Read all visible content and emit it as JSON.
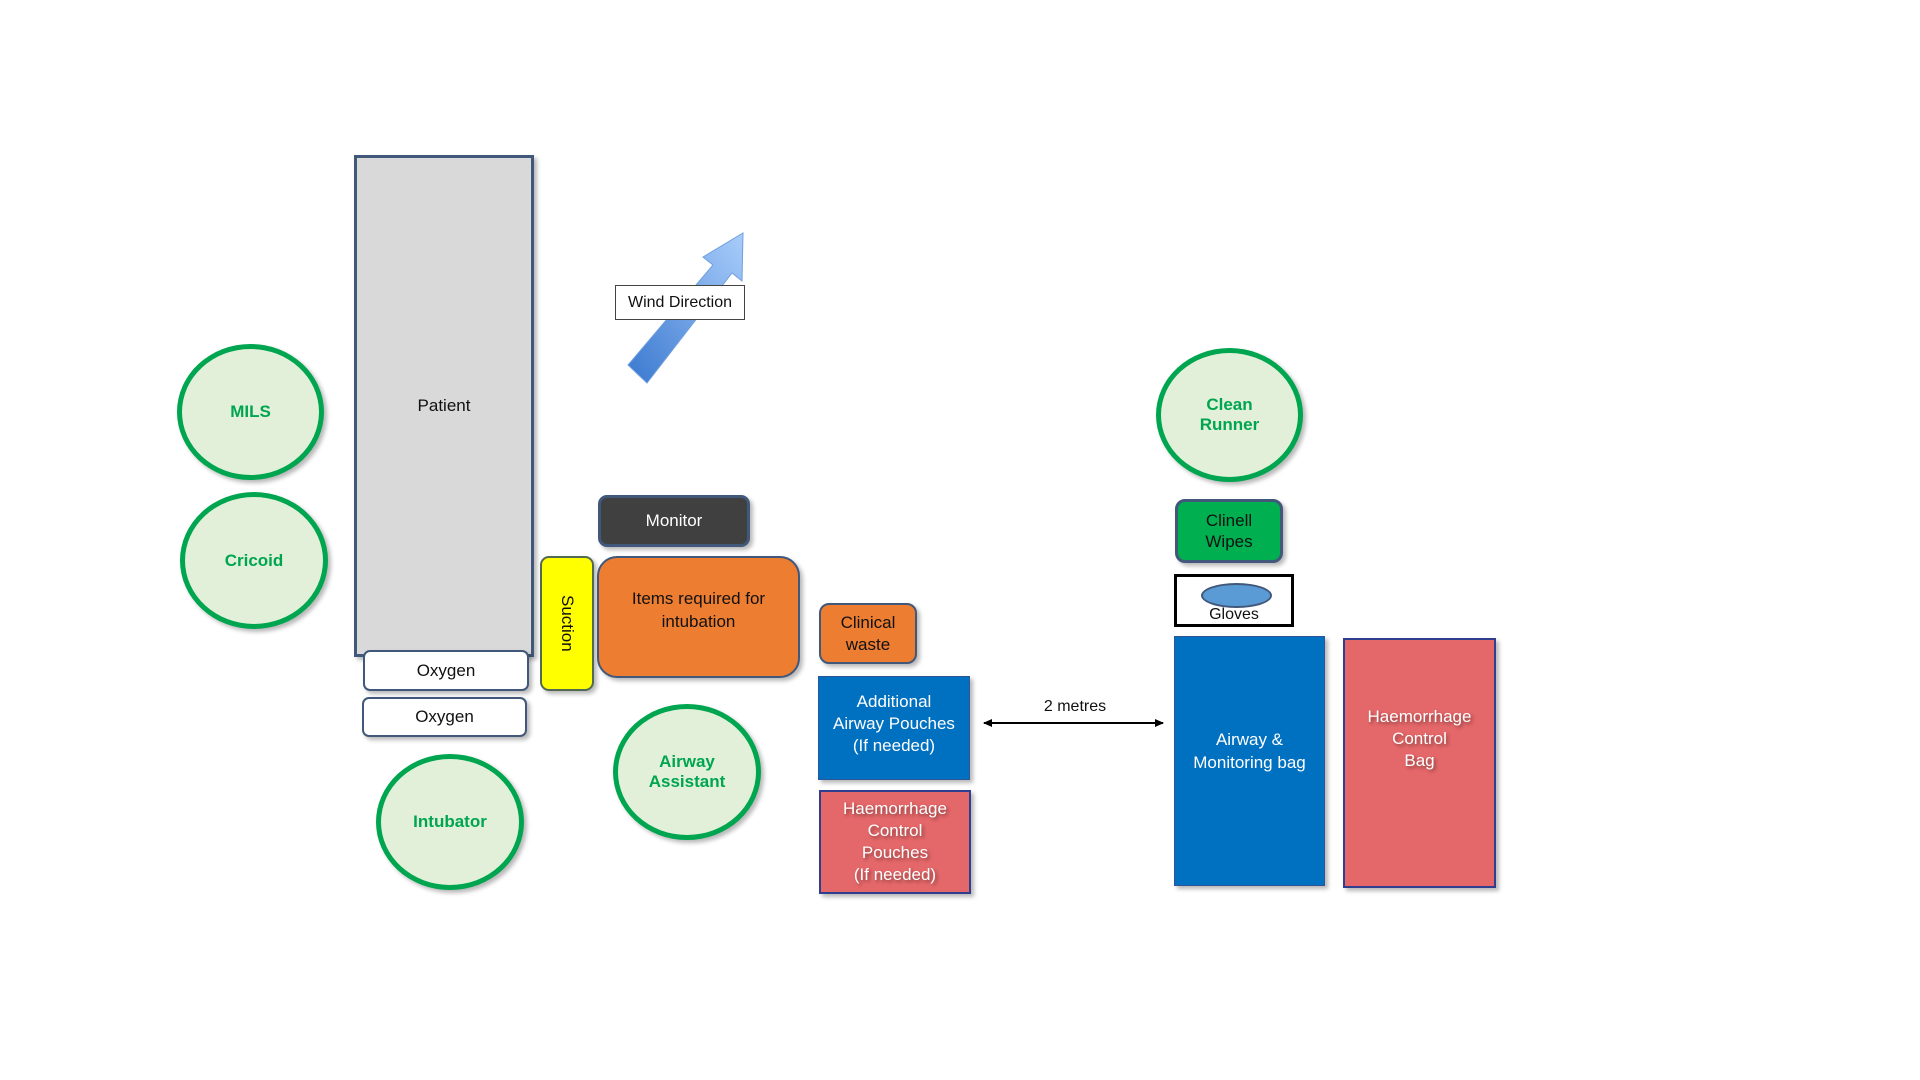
{
  "diagram": {
    "patient": "Patient",
    "roles": {
      "mils": "MILS",
      "cricoid": "Cricoid",
      "intubator": "Intubator",
      "airway_assistant": "Airway\nAssistant",
      "clean_runner": "Clean\nRunner"
    },
    "equipment": {
      "oxygen_1": "Oxygen",
      "oxygen_2": "Oxygen",
      "suction": "Suction",
      "monitor": "Monitor",
      "items_intubation": "Items required for\nintubation",
      "clinical_waste": "Clinical\nwaste",
      "additional_airway_pouches": "Additional\nAirway Pouches\n(If needed)",
      "haemorrhage_control_pouches": "Haemorrhage\nControl\nPouches\n(If needed)",
      "clinell_wipes": "Clinell\nWipes",
      "gloves": "Gloves",
      "airway_monitoring_bag": "Airway &\nMonitoring bag",
      "haemorrhage_control_bag": "Haemorrhage\nControl\nBag"
    },
    "wind_direction_label": "Wind Direction",
    "distance_label": "2 metres",
    "colors": {
      "role_fill": "#e2f0d9",
      "role_stroke": "#00a550",
      "patient_fill": "#d9d9d9",
      "orange": "#ed7d31",
      "blue": "#0070c0",
      "red": "#e46769",
      "yellow": "#ffff00",
      "monitor": "#404040",
      "wipes_green": "#00b050",
      "wind_arrow": "#5b9bd5"
    }
  }
}
